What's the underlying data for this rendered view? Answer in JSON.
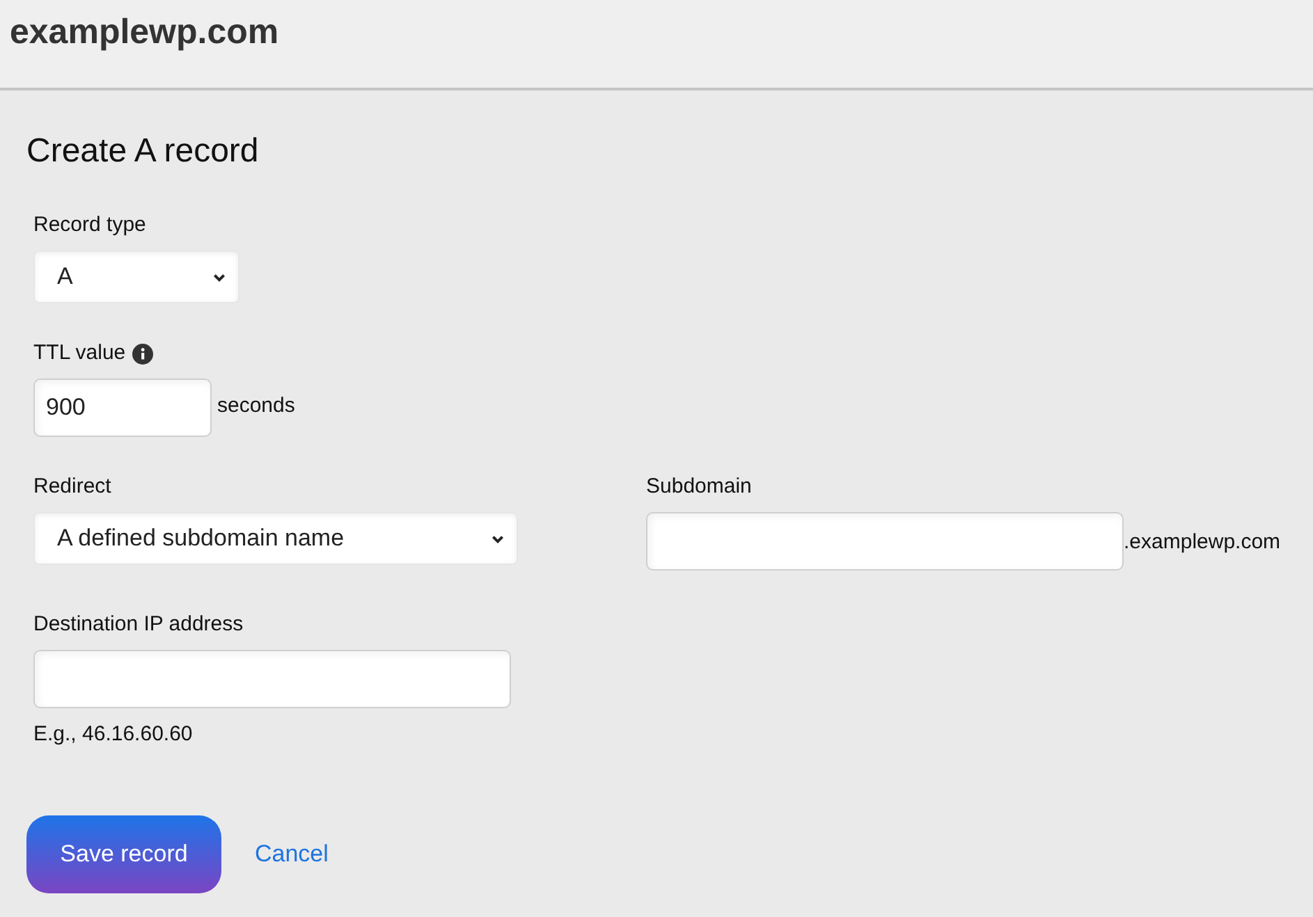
{
  "site_title": "examplewp.com",
  "form": {
    "title": "Create A record",
    "record_type": {
      "label": "Record type",
      "value": "A"
    },
    "ttl": {
      "label": "TTL value",
      "value": "900",
      "unit": "seconds"
    },
    "redirect": {
      "label": "Redirect",
      "value": "A defined subdomain name"
    },
    "subdomain": {
      "label": "Subdomain",
      "suffix": ".examplewp.com"
    },
    "destination_ip": {
      "label": "Destination IP address",
      "hint": "E.g., 46.16.60.60"
    }
  },
  "actions": {
    "save": "Save record",
    "cancel": "Cancel"
  }
}
